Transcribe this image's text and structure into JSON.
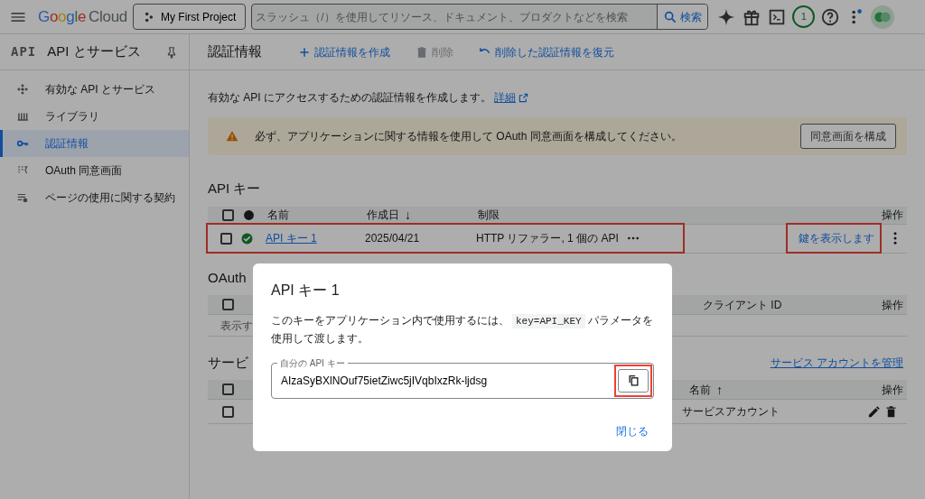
{
  "topbar": {
    "logo": "Google",
    "logo_suffix": "Cloud",
    "project": "My First Project",
    "search": {
      "placeholder": "スラッシュ（/）を使用してリソース、ドキュメント、プロダクトなどを検索"
    },
    "search_button": "検索",
    "notifications": "1"
  },
  "sidebar": {
    "logo": "API",
    "title": "API とサービス",
    "items": [
      {
        "label": "有効な API とサービス",
        "kind": "apis",
        "selected": false
      },
      {
        "label": "ライブラリ",
        "kind": "library",
        "selected": false
      },
      {
        "label": "認証情報",
        "kind": "key",
        "selected": true
      },
      {
        "label": "OAuth 同意画面",
        "kind": "consent",
        "selected": false
      },
      {
        "label": "ページの使用に関する契約",
        "kind": "agreements",
        "selected": false
      }
    ]
  },
  "header": {
    "title": "認証情報",
    "actions": [
      {
        "label": "認証情報を作成",
        "kind": "create",
        "disabled": false
      },
      {
        "label": "削除",
        "kind": "delete",
        "disabled": true
      },
      {
        "label": "削除した認証情報を復元",
        "kind": "restore",
        "disabled": false
      }
    ]
  },
  "intro": {
    "text": "有効な API にアクセスするための認証情報を作成します。",
    "link": "詳細"
  },
  "alert": {
    "text": "必ず、アプリケーションに関する情報を使用して OAuth 同意画面を構成してください。",
    "button": "同意画面を構成"
  },
  "api_keys": {
    "heading": "API キー",
    "header_checked": false,
    "columns": [
      {
        "label": "名前"
      },
      {
        "label": "作成日",
        "sort_arrow": "↓"
      },
      {
        "label": "制限"
      },
      {
        "label": "操作"
      }
    ],
    "rows": [
      {
        "checked": false,
        "status_ok": true,
        "name": "API キー 1",
        "created": "2025/04/21",
        "restrictions": "HTTP リファラー, 1 個の API",
        "action": "鍵を表示します",
        "highlighted": true,
        "action_highlighted": true
      }
    ]
  },
  "oauth": {
    "heading": "OAuth",
    "header_checked": false,
    "columns": [
      {
        "label": "クライアント ID"
      },
      {
        "label": "操作"
      }
    ],
    "empty_text": "表示す"
  },
  "service_accounts": {
    "heading": "サービ",
    "manage_link": "サービス アカウントを管理",
    "header_checked": false,
    "columns": [
      {
        "label": "名前",
        "sort_arrow": "↑"
      },
      {
        "label": "操作"
      }
    ],
    "rows": [
      {
        "checked": false,
        "name": "サービスアカウント"
      }
    ]
  },
  "dialog": {
    "title": "API キー 1",
    "text_before": "このキーをアプリケーション内で使用するには、",
    "code": "key=API_KEY",
    "text_after": "パラメータを使用して渡します。",
    "field_label": "自分の API キー",
    "value": "AIzaSyBXlNOuf75ietZiwc5jIVqbIxzRk-ljdsg",
    "copy_highlighted": true,
    "close": "閉じる"
  }
}
